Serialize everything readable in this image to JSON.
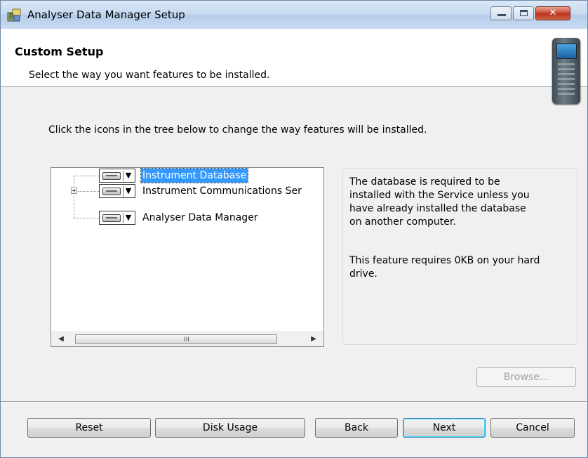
{
  "window": {
    "title": "Analyser Data Manager Setup",
    "icon": "installer-icon"
  },
  "header": {
    "title": "Custom Setup",
    "subtitle": "Select the way you want features to be installed.",
    "graphic": "handheld-device-icon"
  },
  "instruction": "Click the icons in the tree below to change the way features will be installed.",
  "tree": {
    "items": [
      {
        "label": "Instrument Database",
        "selected": true,
        "expandable": false
      },
      {
        "label": "Instrument Communications Ser",
        "selected": false,
        "expandable": true
      },
      {
        "label": "Analyser Data Manager",
        "selected": false,
        "expandable": false
      }
    ],
    "scroll_grip": "III"
  },
  "description": {
    "text": "The database is required to be\ninstalled with the Service unless you\nhave already installed the database\non another computer.",
    "requirement": "This feature requires 0KB on your hard drive."
  },
  "buttons": {
    "browse": "Browse...",
    "reset": "Reset",
    "disk_usage": "Disk Usage",
    "back": "Back",
    "next": "Next",
    "cancel": "Cancel"
  },
  "colors": {
    "selection": "#3399ff",
    "default_button_border": "#3c7fb1",
    "close_button": "#c7452c"
  }
}
